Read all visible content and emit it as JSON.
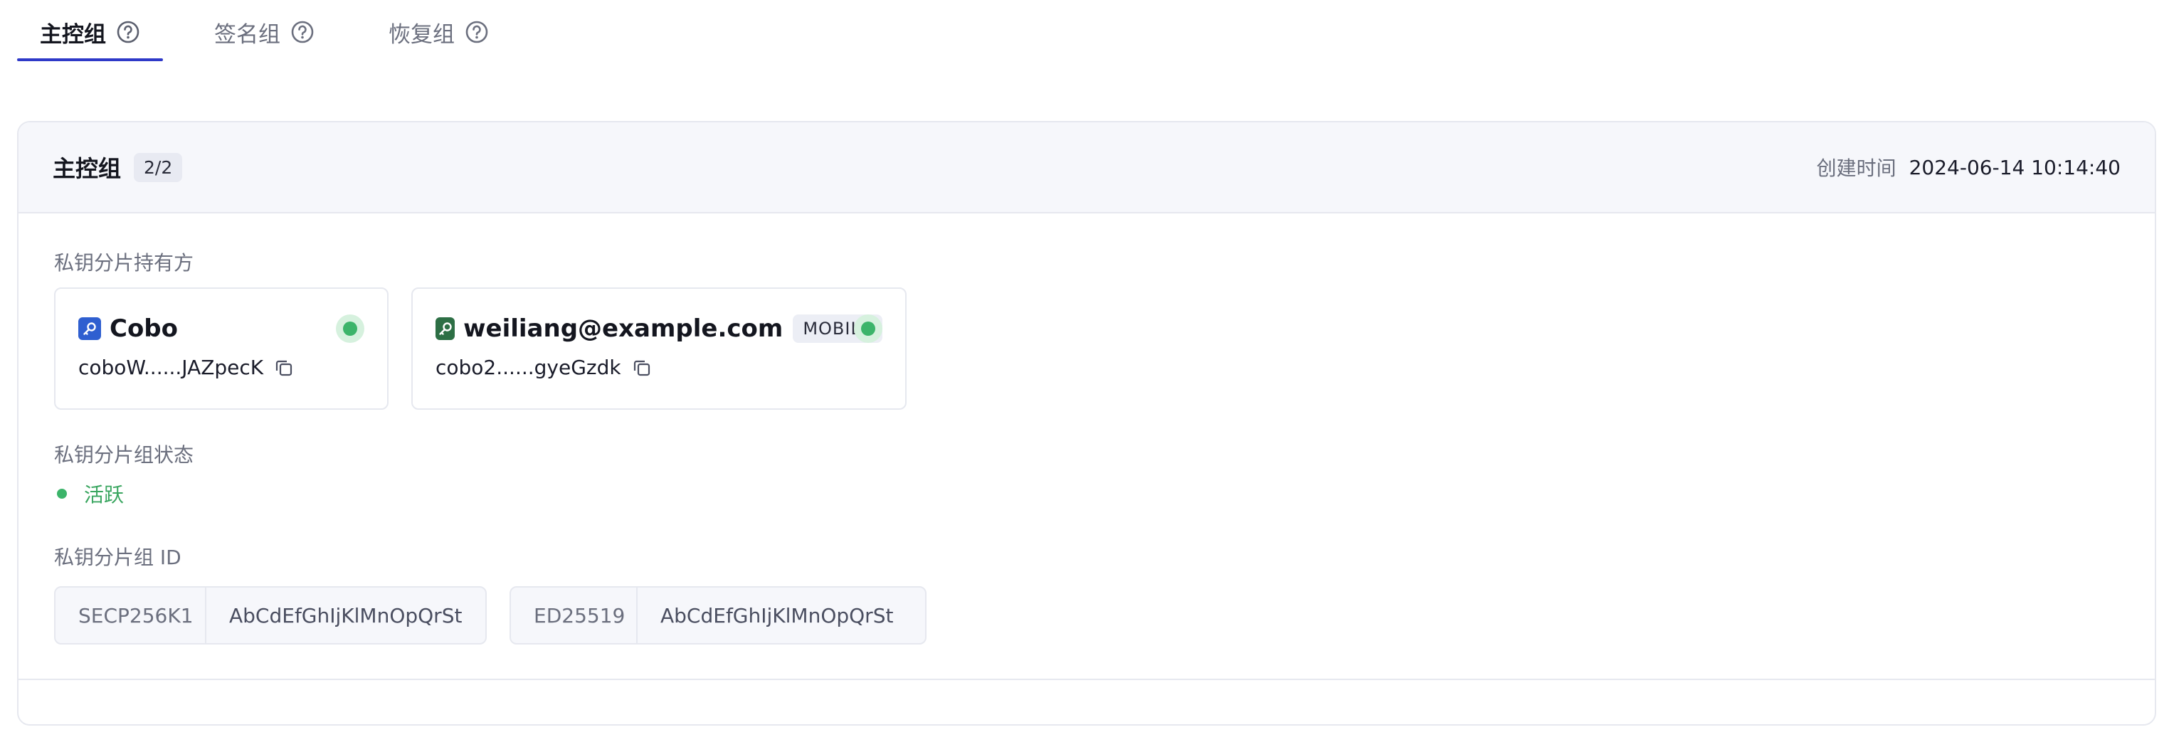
{
  "tabs": [
    {
      "label": "主控组",
      "active": true
    },
    {
      "label": "签名组",
      "active": false
    },
    {
      "label": "恢复组",
      "active": false
    }
  ],
  "group": {
    "title": "主控组",
    "count": "2/2",
    "created_label": "创建时间",
    "created_value": "2024-06-14 10:14:40"
  },
  "holders_label": "私钥分片持有方",
  "holders": [
    {
      "name": "Cobo",
      "address": "coboW......JAZpecK",
      "tag": "",
      "icon": "key-icon",
      "icon_color": "#2f5fd0"
    },
    {
      "name": "weiliang@example.com",
      "address": "cobo2......gyeGzdk",
      "tag": "MOBILE",
      "icon": "key-icon",
      "icon_color": "#2d6f45"
    }
  ],
  "state_label": "私钥分片组状态",
  "state_value": "活跃",
  "id_label": "私钥分片组 ID",
  "ids": [
    {
      "curve": "SECP256K1",
      "value": "AbCdEfGhIjKlMnOpQrSt"
    },
    {
      "curve": "ED25519",
      "value": "AbCdEfGhIjKlMnOpQrSt"
    }
  ],
  "colors": {
    "accent": "#2e39c8",
    "status_green": "#3cb46a"
  }
}
